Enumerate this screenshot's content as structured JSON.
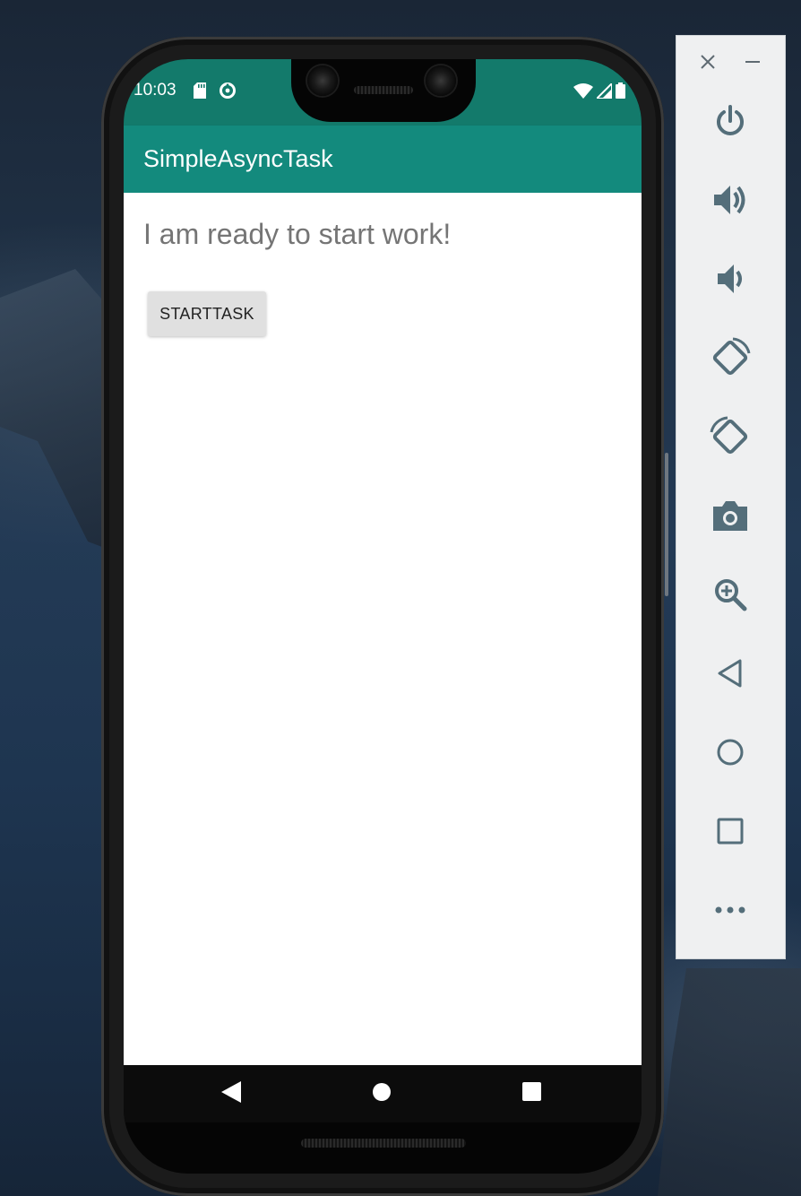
{
  "status_bar": {
    "time": "10:03",
    "background_color": "#137a6b",
    "left_icons": [
      "sd-card-icon",
      "data-saver-icon"
    ],
    "right_icons": [
      "wifi-icon",
      "cell-signal-icon",
      "battery-icon"
    ]
  },
  "app_bar": {
    "title": "SimpleAsyncTask",
    "background_color": "#138a7d"
  },
  "content": {
    "status_text": "I am ready to start work!",
    "start_button_label": "STARTTASK"
  },
  "nav_bar": {
    "buttons": [
      "back-icon",
      "home-icon",
      "recents-icon"
    ]
  },
  "emulator_toolbar": {
    "window_controls": [
      "close-icon",
      "minimize-icon"
    ],
    "items": [
      "power-icon",
      "volume-up-icon",
      "volume-down-icon",
      "rotate-left-icon",
      "rotate-right-icon",
      "camera-icon",
      "zoom-icon",
      "back-icon",
      "home-icon",
      "overview-icon",
      "more-icon"
    ],
    "icon_color": "#546e7a"
  }
}
